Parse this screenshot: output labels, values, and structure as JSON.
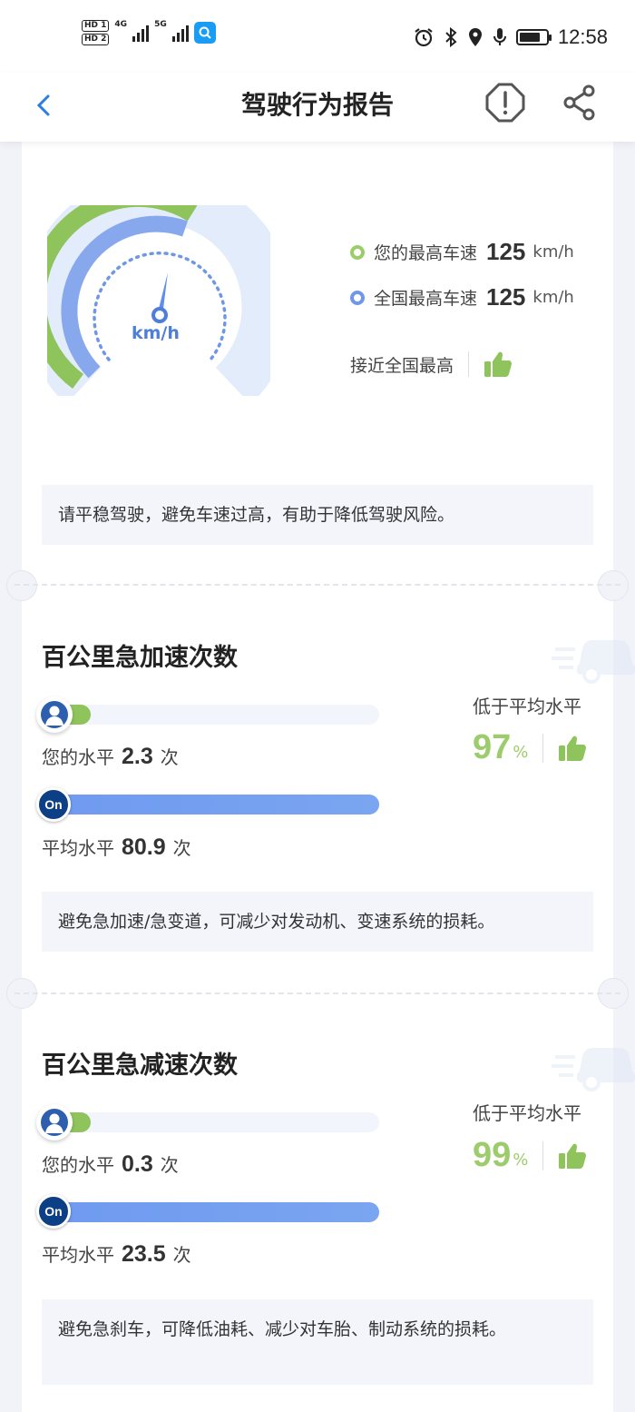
{
  "status_bar": {
    "hd1": "HD 1",
    "hd2": "HD 2",
    "net1": "4G",
    "net2": "5G",
    "time": "12:58"
  },
  "header": {
    "title": "驾驶行为报告"
  },
  "speed": {
    "gauge_unit": "km/h",
    "your_label": "您的最高车速",
    "your_value": "125",
    "national_label": "全国最高车速",
    "national_value": "125",
    "unit": "km/h",
    "verdict": "接近全国最高",
    "tip": "请平稳驾驶，避免车速过高，有助于降低驾驶风险。",
    "colors": {
      "you": "#8fc45c",
      "national": "#6f97e6"
    }
  },
  "acceleration": {
    "title": "百公里急加速次数",
    "your_label": "您的水平",
    "your_value": "2.3",
    "avg_label": "平均水平",
    "avg_value": "80.9",
    "count_unit": "次",
    "compare_label": "低于平均水平",
    "percent": "97",
    "percent_sign": "%",
    "tip": "避免急加速/急变道，可减少对发动机、变速系统的损耗。"
  },
  "deceleration": {
    "title": "百公里急减速次数",
    "your_label": "您的水平",
    "your_value": "0.3",
    "avg_label": "平均水平",
    "avg_value": "23.5",
    "count_unit": "次",
    "compare_label": "低于平均水平",
    "percent": "99",
    "percent_sign": "%",
    "tip": "避免急刹车，可降低油耗、减少对车胎、制动系统的损耗。"
  },
  "badge_text": "On"
}
